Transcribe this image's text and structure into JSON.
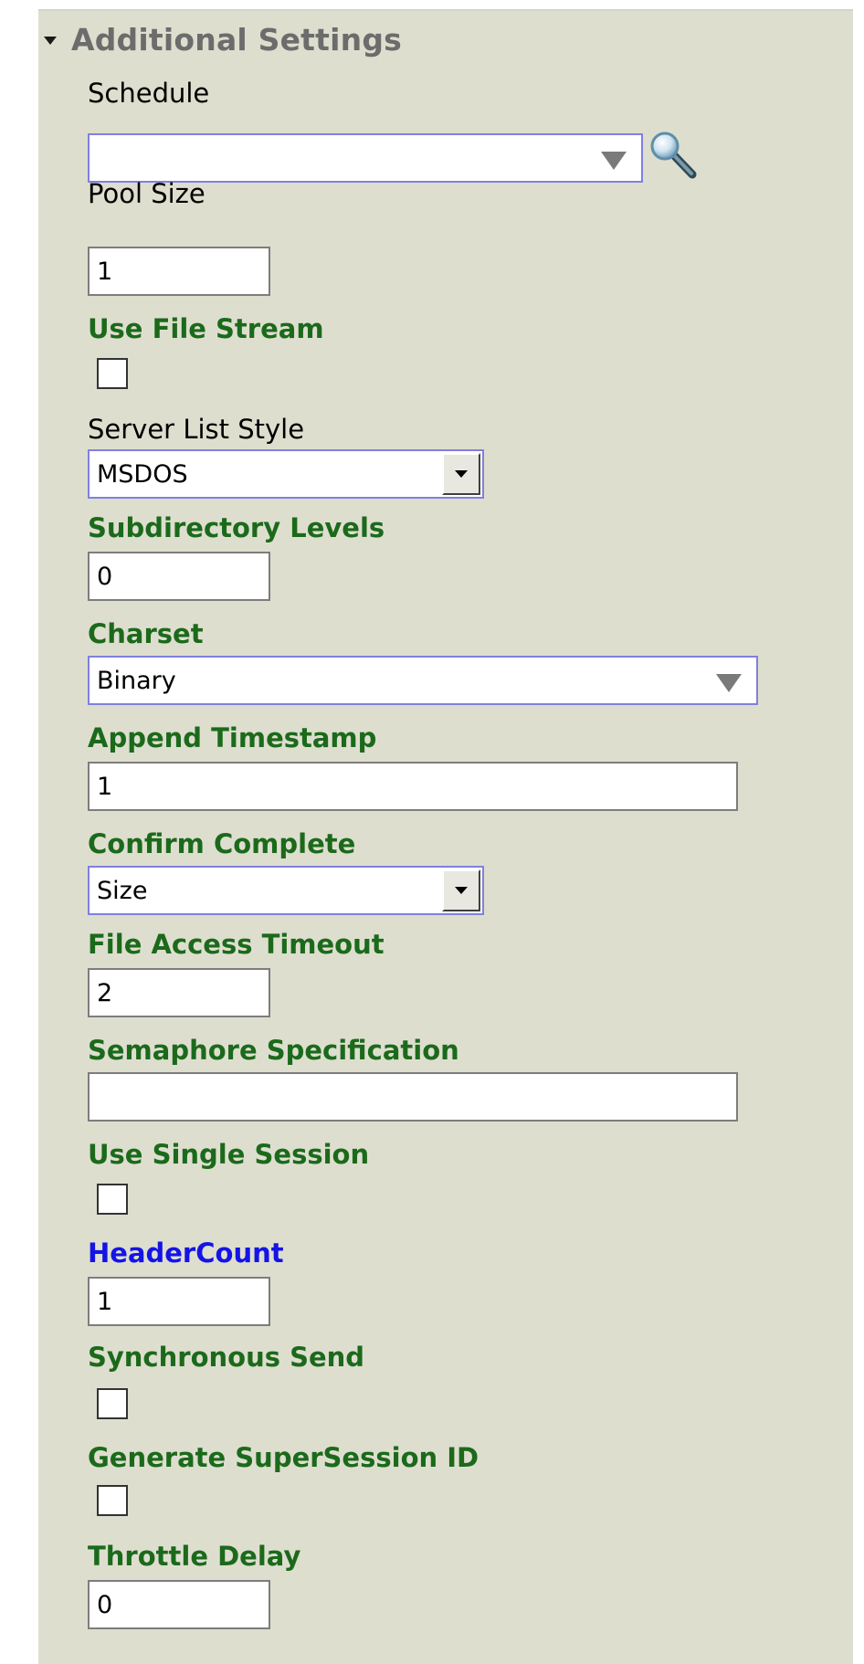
{
  "section": {
    "title": "Additional Settings",
    "icon": "caret-down-icon"
  },
  "schedule": {
    "label": "Schedule",
    "value": "",
    "lookup_icon": "magnifier-icon"
  },
  "pool_size": {
    "label": "Pool Size",
    "value": "1"
  },
  "use_filestream": {
    "label": "Use File Stream",
    "checked": false
  },
  "server_list_style": {
    "label": "Server List Style",
    "value": "MSDOS"
  },
  "subdirectory_levels": {
    "label": "Subdirectory Levels",
    "value": "0"
  },
  "charset": {
    "label": "Charset",
    "value": "Binary"
  },
  "append_timestamp": {
    "label": "Append Timestamp",
    "value": "1"
  },
  "confirm_complete": {
    "label": "Confirm Complete",
    "value": "Size"
  },
  "file_access_timeout": {
    "label": "File Access Timeout",
    "value": "2"
  },
  "semaphore_specification": {
    "label": "Semaphore Specification",
    "value": ""
  },
  "use_single_session": {
    "label": "Use Single Session",
    "checked": false
  },
  "header_count": {
    "label": "HeaderCount",
    "value": "1"
  },
  "synchronous_send": {
    "label": "Synchronous Send",
    "checked": false
  },
  "generate_supersession_id": {
    "label": "Generate SuperSession ID",
    "checked": false
  },
  "throttle_delay": {
    "label": "Throttle Delay",
    "value": "0"
  },
  "colors": {
    "panel_bg": "#dedecf",
    "label_green": "#1b6a1b",
    "label_blue": "#1414e6",
    "header_gray": "#6c6c6c",
    "focus_border": "#8080e0"
  }
}
